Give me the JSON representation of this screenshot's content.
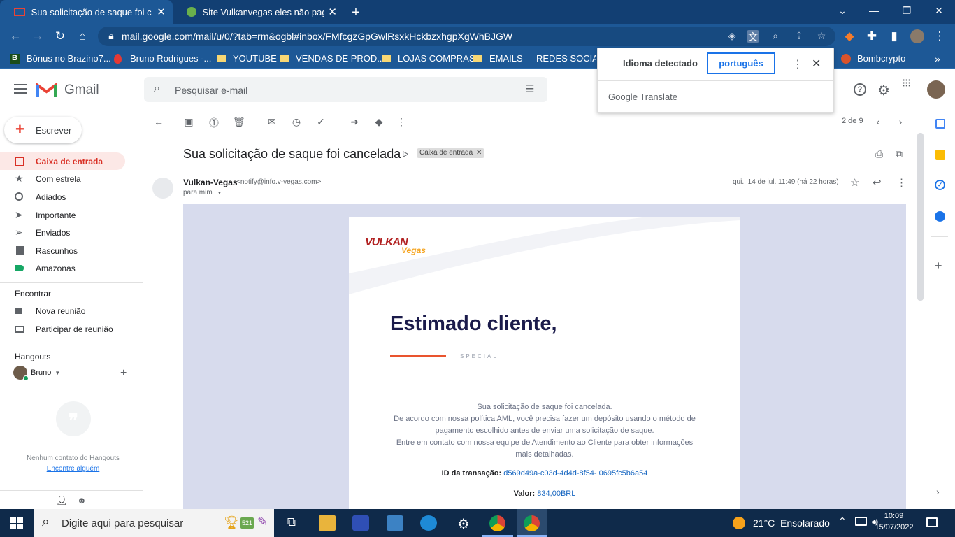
{
  "browser": {
    "tabs": [
      {
        "title": "Sua solicitação de saque foi canc",
        "active": true
      },
      {
        "title": "Site Vulkanvegas eles não pagam",
        "active": false
      }
    ],
    "url": "mail.google.com/mail/u/0/?tab=rm&ogbl#inbox/FMfcgzGpGwlRsxkHckbzxhgpXgWhBJGW",
    "bookmarks": [
      "Bônus no Brazino7...",
      "Bruno Rodrigues -...",
      "YOUTUBE",
      "VENDAS DE PROD...",
      "LOJAS COMPRAS",
      "EMAILS",
      "REDES SOCIAI",
      "Bombcrypto"
    ]
  },
  "translate": {
    "detected_label": "Idioma detectado",
    "target_language": "português",
    "brand_google": "Google",
    "brand_translate": "Translate"
  },
  "gmail": {
    "logo_text": "Gmail",
    "search_placeholder": "Pesquisar e-mail",
    "compose_label": "Escrever",
    "nav": [
      {
        "label": "Caixa de entrada",
        "selected": true
      },
      {
        "label": "Com estrela"
      },
      {
        "label": "Adiados"
      },
      {
        "label": "Importante"
      },
      {
        "label": "Enviados"
      },
      {
        "label": "Rascunhos"
      },
      {
        "label": "Amazonas"
      }
    ],
    "meet": {
      "heading": "Encontrar",
      "items": [
        "Nova reunião",
        "Participar de reunião"
      ]
    },
    "hangouts": {
      "heading": "Hangouts",
      "user": "Bruno",
      "empty_text": "Nenhum contato do Hangouts",
      "find_link": "Encontre alguém"
    },
    "pagination": "2 de 9"
  },
  "email": {
    "subject": "Sua solicitação de saque foi cancelada",
    "label_chip": "Caixa de entrada",
    "sender_name": "Vulkan-Vegas",
    "sender_email": "<notify@info.v-vegas.com>",
    "to": "para mim",
    "date": "qui., 14 de jul. 11:49 (há 22 horas)",
    "brand_logo_text": "VULKAN",
    "brand_logo_sub": "Vegas",
    "greeting": "Estimado cliente,",
    "tagline": "SPECIAL",
    "body_lines": [
      "Sua solicitação de saque foi cancelada.",
      "De acordo com nossa política AML, você precisa fazer um depósito usando o método de",
      "pagamento escolhido antes de enviar uma solicitação de saque.",
      "Entre em contato com nossa equipe de Atendimento ao Cliente para obter informações",
      "mais detalhadas."
    ],
    "transaction_label": "ID da transação:",
    "transaction_id": "d569d49a-c03d-4d4d-8f54- 0695fc5b6a54",
    "value_label": "Valor:",
    "value": "834,00BRL"
  },
  "taskbar": {
    "search_placeholder": "Digite aqui para pesquisar",
    "badge": "521",
    "weather": "21°C  Ensolarado",
    "time": "10:09",
    "date": "15/07/2022"
  },
  "colors": {
    "chrome_dark": "#123f73",
    "chrome_tab": "#1d5896",
    "gmail_red": "#d93025",
    "link_blue": "#1a73e8",
    "email_bg": "#d7dbed",
    "greeting": "#1b1b4b",
    "accent_orange": "#e9542e"
  }
}
